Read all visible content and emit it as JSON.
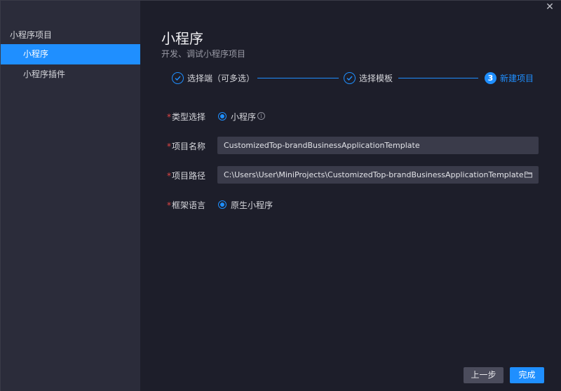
{
  "sidebar": {
    "group_title": "小程序项目",
    "items": [
      {
        "label": "小程序",
        "active": true
      },
      {
        "label": "小程序插件",
        "active": false
      }
    ]
  },
  "window": {
    "close_glyph": "✕"
  },
  "header": {
    "title": "小程序",
    "subtitle": "开发、调试小程序项目"
  },
  "steps": [
    {
      "label": "选择端（可多选）",
      "state": "done"
    },
    {
      "label": "选择模板",
      "state": "done"
    },
    {
      "number": "3",
      "label": "新建项目",
      "state": "current"
    }
  ],
  "form": {
    "type": {
      "label": "类型选择",
      "option": "小程序",
      "info_icon": "info-icon"
    },
    "name": {
      "label": "项目名称",
      "value": "CustomizedTop-brandBusinessApplicationTemplate"
    },
    "path": {
      "label": "项目路径",
      "value": "C:\\Users\\User\\MiniProjects\\CustomizedTop-brandBusinessApplicationTemplate",
      "icon": "folder-icon"
    },
    "framework": {
      "label": "框架语言",
      "option": "原生小程序"
    }
  },
  "footer": {
    "prev_label": "上一步",
    "done_label": "完成"
  },
  "colors": {
    "accent": "#1f8fff",
    "sidebar_bg": "#2b2c3a",
    "main_bg": "#1d1e2a",
    "input_bg": "#3a3b4a",
    "required": "#e04545"
  }
}
